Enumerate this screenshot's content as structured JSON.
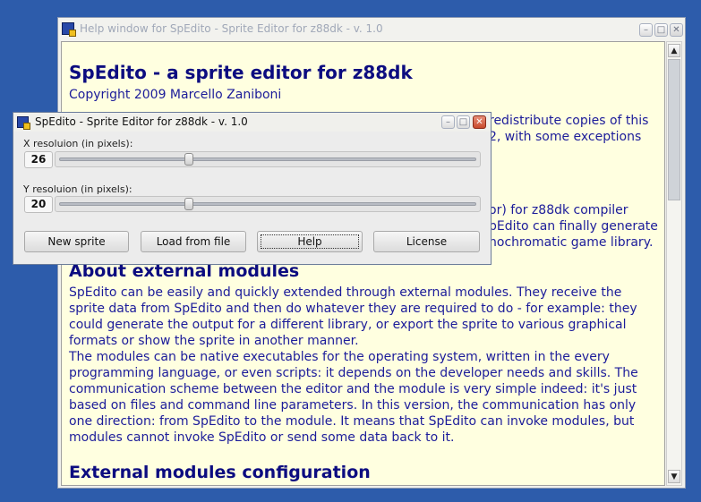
{
  "help_window": {
    "title": "Help window for SpEdito - Sprite Editor for z88dk - v. 1.0",
    "controls": {
      "minimize": "–",
      "maximize": "□",
      "close": "✕"
    },
    "content": {
      "heading": "SpEdito - a sprite editor for z88dk",
      "copyright": "Copyright 2009 Marcello Zaniboni",
      "license_fragment_1": "redistribute copies of this",
      "license_fragment_2": "2, with some exceptions",
      "intro_fragment_1": "or) for z88dk compiler",
      "intro_fragment_2": "pEdito can finally generate",
      "intro_fragment_3": "nochromatic game library.",
      "section_about": "About external modules",
      "about_p1": "SpEdito can be easily and quickly extended through external modules. They receive the sprite data from SpEdito and then do whatever they are required to do - for example: they could generate the output for a different library, or export the sprite to various graphical formats or show the sprite in another manner.",
      "about_p2": "The modules can be native executables for the operating system, written in the every programming language, or even scripts: it depends on the developer needs and skills. The communication scheme between the editor and the module is very simple indeed: it's just based on files and command line parameters. In this version, the communication has only one direction: from SpEdito to the module. It means that SpEdito can invoke modules, but modules cannot invoke SpEdito or send some data back to it.",
      "section_config": "External modules configuration"
    },
    "scrollbar": {
      "up": "▲",
      "down": "▼"
    }
  },
  "main_window": {
    "title": "SpEdito - Sprite Editor for z88dk - v. 1.0",
    "controls": {
      "minimize": "–",
      "maximize": "□",
      "close": "✕"
    },
    "x_label": "X resoluion (in pixels):",
    "x_value": "26",
    "x_slider_fraction": 0.31,
    "y_label": "Y resoluion (in pixels):",
    "y_value": "20",
    "y_slider_fraction": 0.31,
    "buttons": {
      "new_sprite": "New sprite",
      "load_from_file": "Load from file",
      "help": "Help",
      "license": "License"
    }
  },
  "colors": {
    "desktop": "#2d5cab",
    "doc_background": "#ffffe0",
    "doc_text": "#1c1c9a"
  }
}
